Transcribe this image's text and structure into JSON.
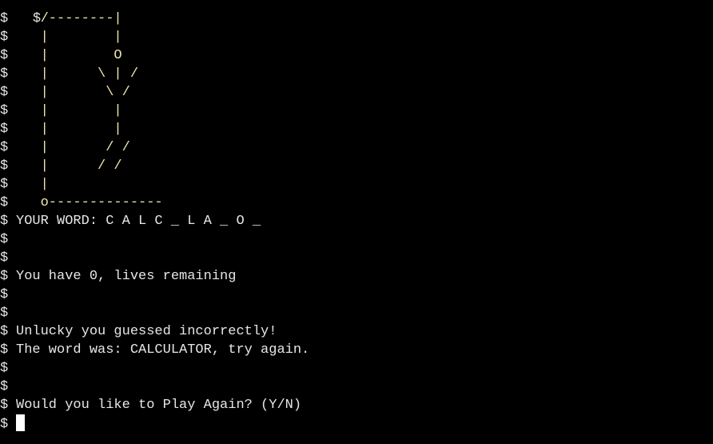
{
  "prompt": "$",
  "lines": [
    {
      "kind": "art",
      "text": "   /--------|"
    },
    {
      "kind": "art",
      "text": "   |        |"
    },
    {
      "kind": "art",
      "text": "   |        O"
    },
    {
      "kind": "art",
      "text": "   |      \\ | /"
    },
    {
      "kind": "art",
      "text": "   |       \\ /"
    },
    {
      "kind": "art",
      "text": "   |        |"
    },
    {
      "kind": "art",
      "text": "   |        |"
    },
    {
      "kind": "art",
      "text": "   |       / /"
    },
    {
      "kind": "art",
      "text": "   |      / /"
    },
    {
      "kind": "art",
      "text": "   |"
    },
    {
      "kind": "art",
      "text": "   o--------------"
    },
    {
      "kind": "text",
      "text": "YOUR WORD: C A L C _ L A _ O _"
    },
    {
      "kind": "text",
      "text": ""
    },
    {
      "kind": "text",
      "text": ""
    },
    {
      "kind": "text",
      "text": "You have 0, lives remaining"
    },
    {
      "kind": "text",
      "text": ""
    },
    {
      "kind": "text",
      "text": ""
    },
    {
      "kind": "text",
      "text": "Unlucky you guessed incorrectly!"
    },
    {
      "kind": "text",
      "text": "The word was: CALCULATOR, try again."
    },
    {
      "kind": "text",
      "text": ""
    },
    {
      "kind": "text",
      "text": ""
    },
    {
      "kind": "text",
      "text": "Would you like to Play Again? (Y/N)"
    }
  ],
  "colors": {
    "background": "#000000",
    "text": "#e6e6e6",
    "art": "#f2e6b0",
    "cursor": "#ffffff"
  }
}
